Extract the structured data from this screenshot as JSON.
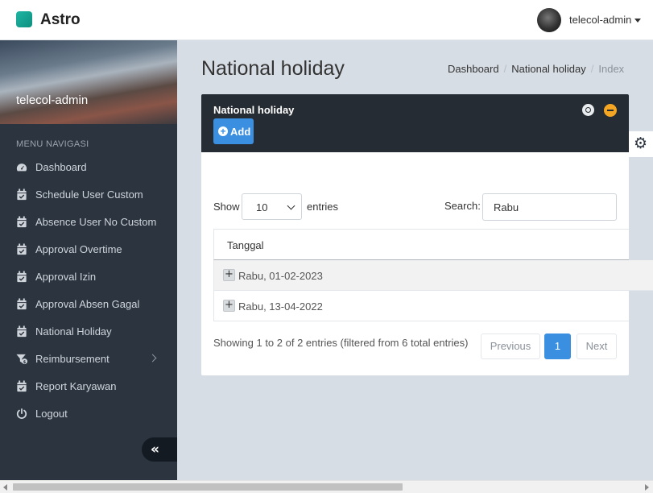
{
  "app": {
    "brand": "Astro",
    "user": "telecol-admin"
  },
  "sidebar": {
    "user": "telecol-admin",
    "menu_header": "MENU NAVIGASI",
    "items": [
      {
        "label": "Dashboard",
        "icon": "dashboard-icon"
      },
      {
        "label": "Schedule User Custom",
        "icon": "calendar-check-icon"
      },
      {
        "label": "Absence User No Custom",
        "icon": "calendar-check-icon"
      },
      {
        "label": "Approval Overtime",
        "icon": "calendar-check-icon"
      },
      {
        "label": "Approval Izin",
        "icon": "calendar-check-icon"
      },
      {
        "label": "Approval Absen Gagal",
        "icon": "calendar-check-icon"
      },
      {
        "label": "National Holiday",
        "icon": "calendar-check-icon"
      },
      {
        "label": "Reimbursement",
        "icon": "funnel-dollar-icon"
      },
      {
        "label": "Report Karyawan",
        "icon": "calendar-check-icon"
      },
      {
        "label": "Logout",
        "icon": "power-icon"
      }
    ],
    "collapse_glyph": "«"
  },
  "page": {
    "title": "National holiday",
    "breadcrumb": [
      "Dashboard",
      "National holiday",
      "Index"
    ]
  },
  "card": {
    "title": "National holiday",
    "add_label": "Add",
    "show_label": "Show",
    "page_length": "10",
    "entries_label": "entries",
    "search_label": "Search:",
    "search_value": "Rabu",
    "table": {
      "columns": [
        "Tanggal"
      ],
      "rows": [
        "Rabu, 01-02-2023",
        "Rabu, 13-04-2022"
      ]
    },
    "info": "Showing 1 to 2 of 2 entries (filtered from 6 total entries)",
    "pagination": {
      "previous": "Previous",
      "current": "1",
      "next": "Next"
    }
  },
  "colors": {
    "accent": "#3a8fe0",
    "sidebar": "#2c3440",
    "card_header": "#262c33",
    "warning": "#f5a623"
  }
}
